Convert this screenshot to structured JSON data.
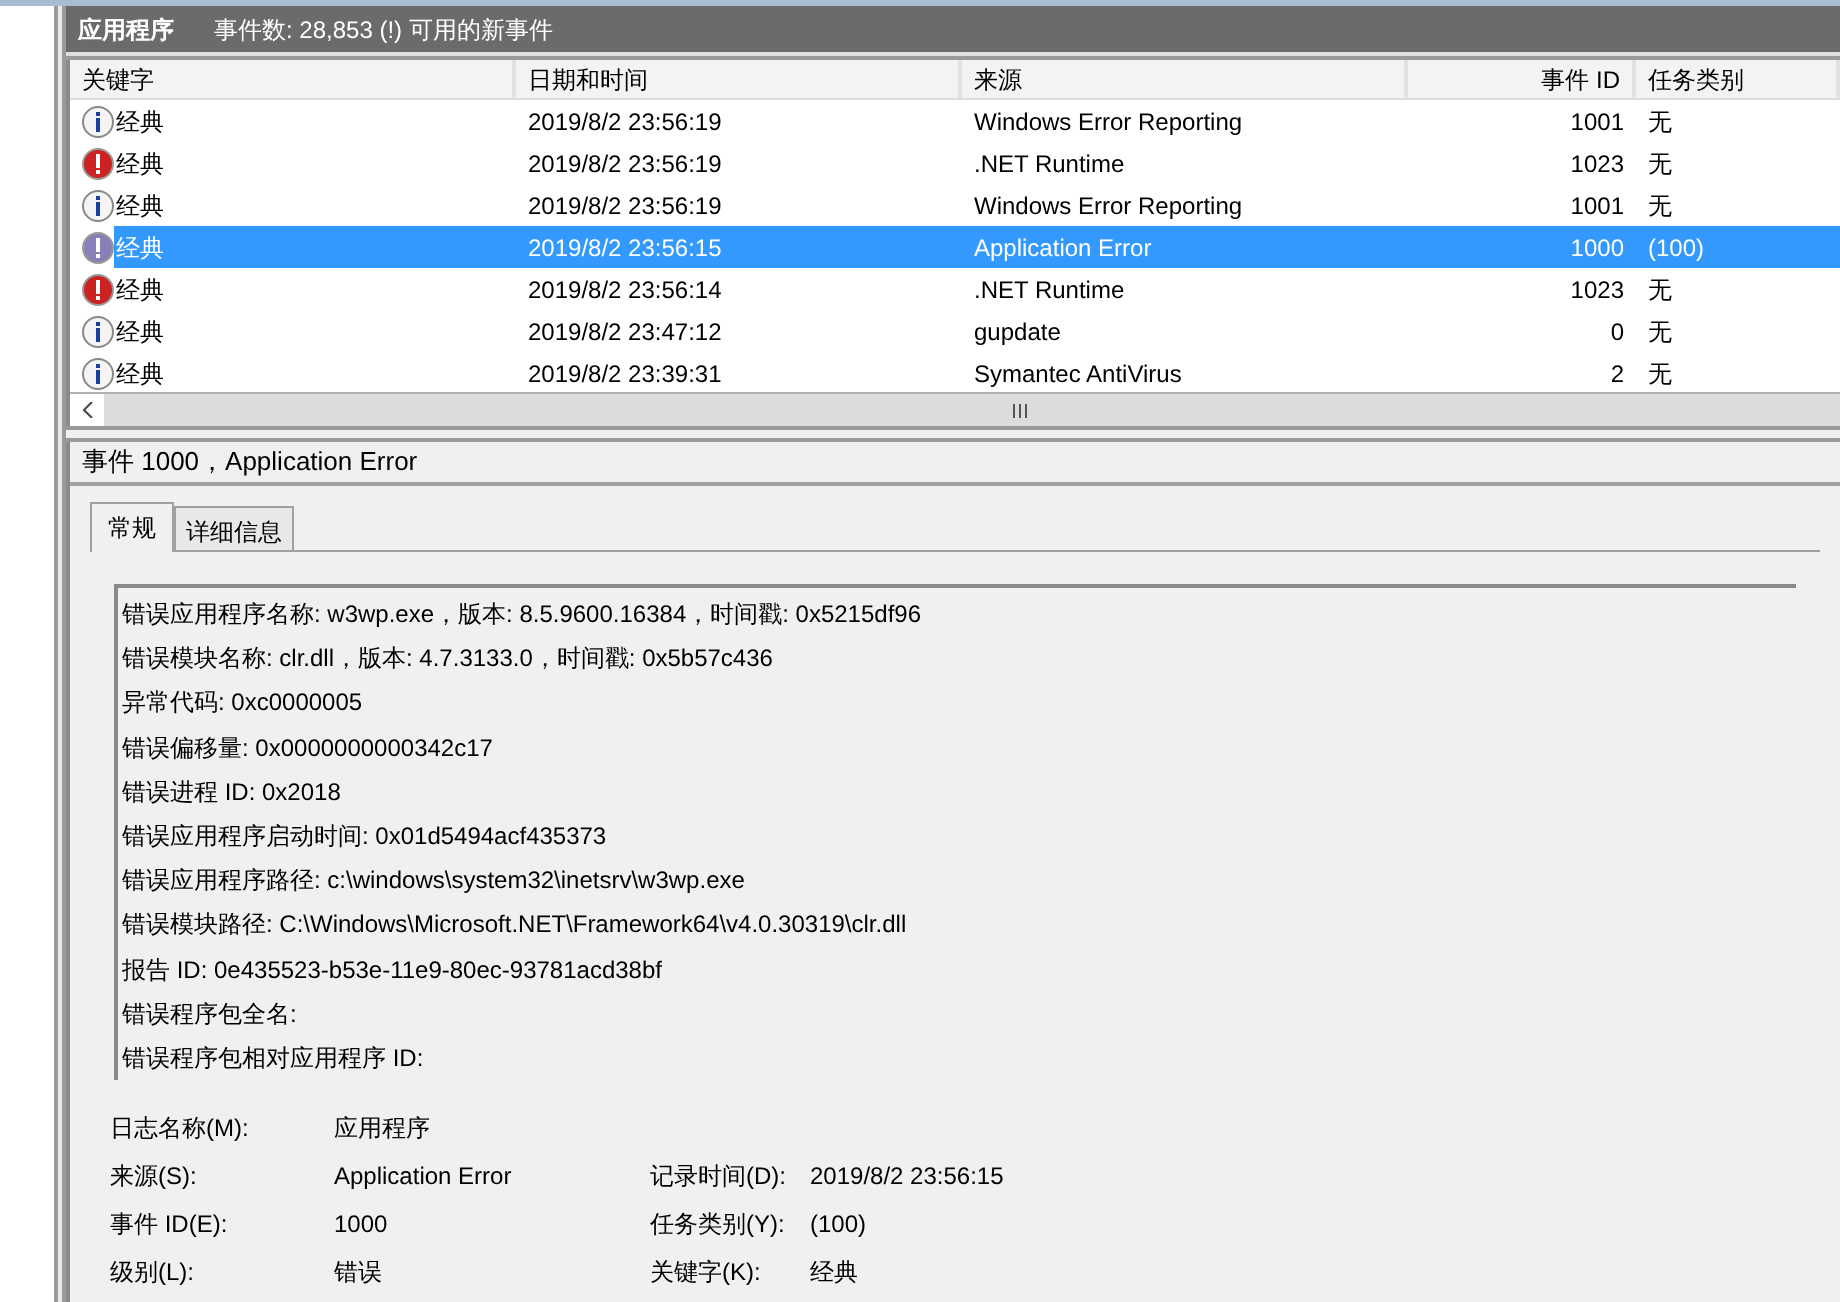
{
  "header": {
    "title": "应用程序",
    "summary": "事件数: 28,853 (!) 可用的新事件"
  },
  "table": {
    "columns": [
      "关键字",
      "日期和时间",
      "来源",
      "事件 ID",
      "任务类别"
    ],
    "rows": [
      {
        "kind": "info",
        "keyword": "经典",
        "datetime": "2019/8/2 23:56:19",
        "source": "Windows Error Reporting",
        "event_id": "1001",
        "task": "无",
        "selected": false
      },
      {
        "kind": "error",
        "keyword": "经典",
        "datetime": "2019/8/2 23:56:19",
        "source": ".NET Runtime",
        "event_id": "1023",
        "task": "无",
        "selected": false
      },
      {
        "kind": "info",
        "keyword": "经典",
        "datetime": "2019/8/2 23:56:19",
        "source": "Windows Error Reporting",
        "event_id": "1001",
        "task": "无",
        "selected": false
      },
      {
        "kind": "error",
        "keyword": "经典",
        "datetime": "2019/8/2 23:56:15",
        "source": "Application Error",
        "event_id": "1000",
        "task": "(100)",
        "selected": true
      },
      {
        "kind": "error",
        "keyword": "经典",
        "datetime": "2019/8/2 23:56:14",
        "source": ".NET Runtime",
        "event_id": "1023",
        "task": "无",
        "selected": false
      },
      {
        "kind": "info",
        "keyword": "经典",
        "datetime": "2019/8/2 23:47:12",
        "source": "gupdate",
        "event_id": "0",
        "task": "无",
        "selected": false
      },
      {
        "kind": "info",
        "keyword": "经典",
        "datetime": "2019/8/2 23:39:31",
        "source": "Symantec AntiVirus",
        "event_id": "2",
        "task": "无",
        "selected": false
      }
    ]
  },
  "detail": {
    "title": "事件 1000，Application Error",
    "tabs": [
      {
        "label": "常规",
        "selected": true
      },
      {
        "label": "详细信息",
        "selected": false
      }
    ],
    "description": [
      "错误应用程序名称: w3wp.exe，版本: 8.5.9600.16384，时间戳: 0x5215df96",
      "错误模块名称: clr.dll，版本: 4.7.3133.0，时间戳: 0x5b57c436",
      "异常代码: 0xc0000005",
      "错误偏移量: 0x0000000000342c17",
      "错误进程 ID: 0x2018",
      "错误应用程序启动时间: 0x01d5494acf435373",
      "错误应用程序路径: c:\\windows\\system32\\inetsrv\\w3wp.exe",
      "错误模块路径: C:\\Windows\\Microsoft.NET\\Framework64\\v4.0.30319\\clr.dll",
      "报告 ID: 0e435523-b53e-11e9-80ec-93781acd38bf",
      "错误程序包全名:",
      "错误程序包相对应用程序 ID:"
    ],
    "fields": [
      [
        {
          "label": "日志名称(M):",
          "value": "应用程序"
        }
      ],
      [
        {
          "label": "来源(S):",
          "value": "Application Error"
        },
        {
          "label": "记录时间(D):",
          "value": "2019/8/2 23:56:15"
        }
      ],
      [
        {
          "label": "事件 ID(E):",
          "value": "1000"
        },
        {
          "label": "任务类别(Y):",
          "value": "(100)"
        }
      ],
      [
        {
          "label": "级别(L):",
          "value": "错误"
        },
        {
          "label": "关键字(K):",
          "value": "经典"
        }
      ]
    ]
  }
}
